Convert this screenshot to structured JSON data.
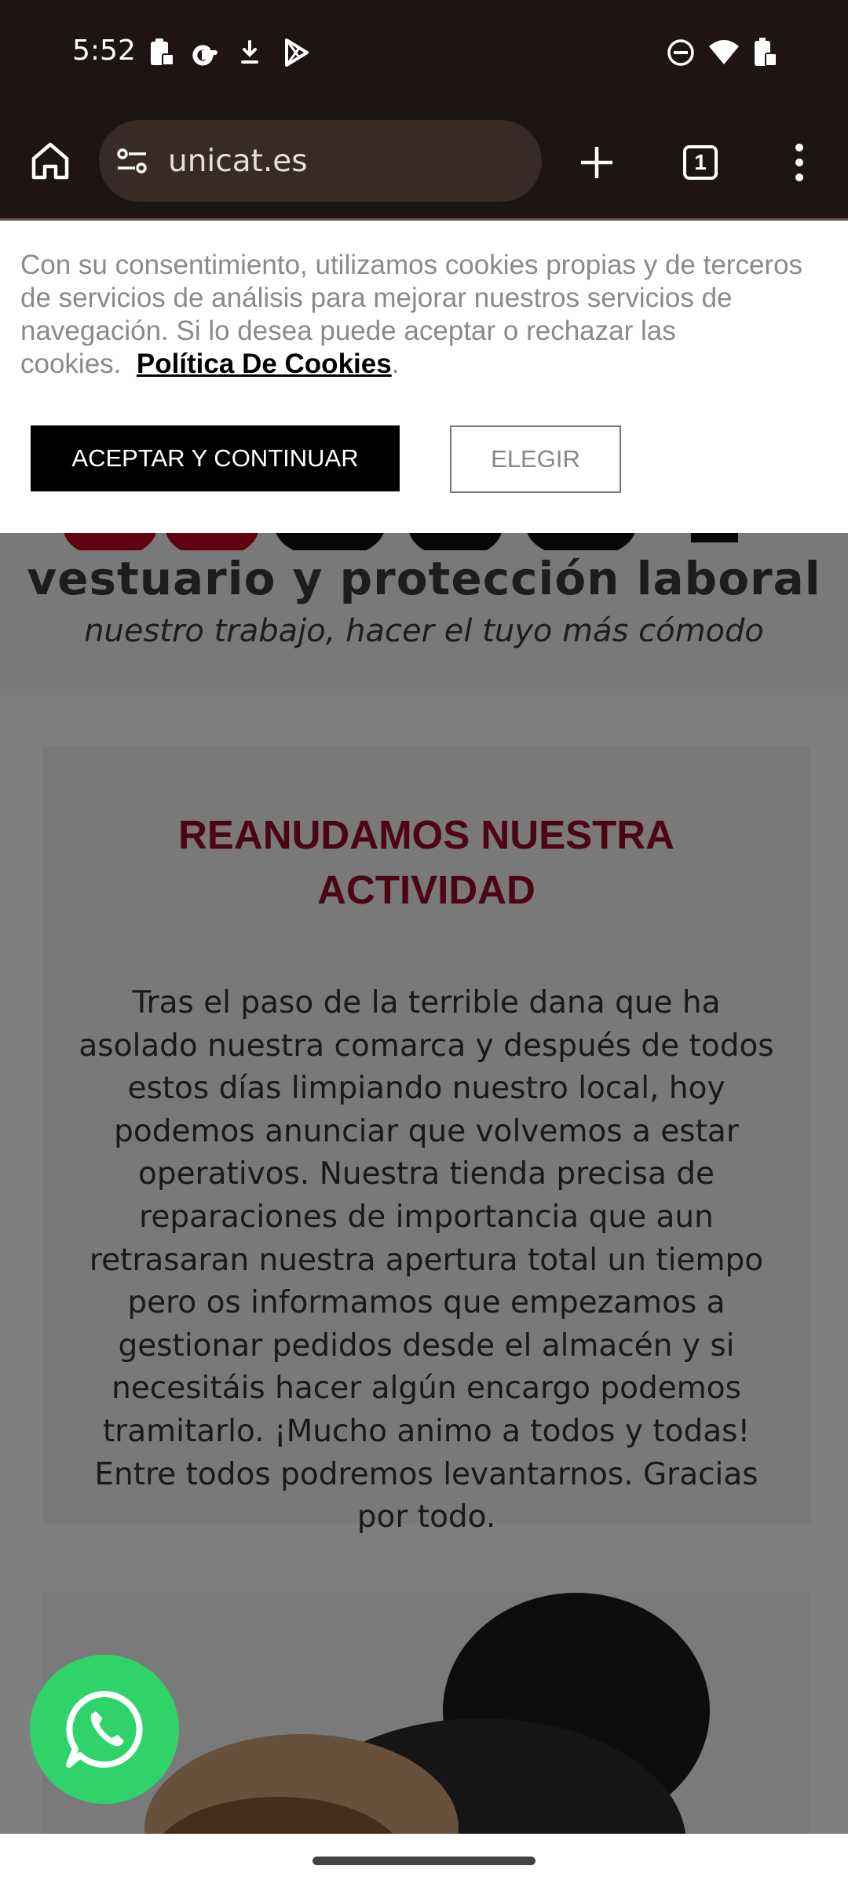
{
  "status_bar": {
    "time": "5:52",
    "left_icons": [
      "clipboard-lock-icon",
      "google-icon",
      "download-icon",
      "play-store-icon"
    ],
    "right_icons": [
      "dnd-icon",
      "wifi-icon",
      "battery-icon"
    ]
  },
  "browser": {
    "url": "unicat.es",
    "tab_count": "1",
    "icons": [
      "home-icon",
      "site-settings-icon",
      "new-tab-icon",
      "tab-switcher-icon",
      "menu-icon"
    ]
  },
  "cookie_banner": {
    "text": "Con su consentimiento, utilizamos cookies propias y de terceros de servicios de análisis para mejorar nuestros servicios de navegación. Si lo desea puede aceptar o rechazar las cookies.",
    "policy_link": "Política De Cookies",
    "after_link": ".",
    "accept_label": "ACEPTAR Y CONTINUAR",
    "choose_label": "ELEGIR"
  },
  "site": {
    "tagline": "vestuario y protección laboral",
    "subtagline": "nuestro trabajo, hacer el tuyo más cómodo",
    "news_title": "REANUDAMOS NUESTRA ACTIVIDAD",
    "news_body": "Tras el paso de la terrible dana que ha asolado nuestra comarca y después de todos estos días limpiando nuestro local, hoy podemos anunciar que volvemos a estar operativos. Nuestra tienda precisa de reparaciones de importancia que aun retrasaran nuestra apertura total un tiempo pero os informamos que empezamos a gestionar pedidos desde el almacén y si necesitáis hacer algún encargo podemos tramitarlo. ¡Mucho animo a todos y todas! Entre todos podremos levantarnos. Gracias por todo."
  },
  "colors": {
    "accent_red": "#9b0a2c",
    "whatsapp_green": "#2fd36a",
    "toolbar_bg": "#1f1414"
  }
}
